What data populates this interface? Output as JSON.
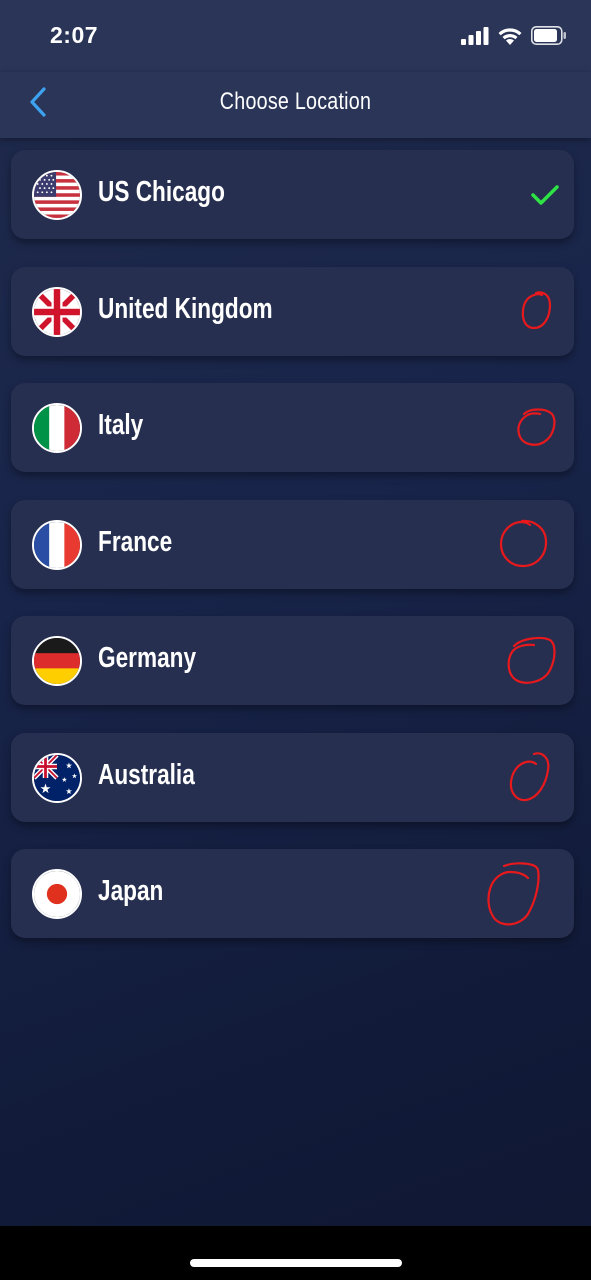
{
  "status_bar": {
    "time": "2:07"
  },
  "nav": {
    "title": "Choose Location",
    "back_icon": "chevron-left-icon"
  },
  "colors": {
    "accent_blue": "#3da2f0",
    "check_green": "#2ee344",
    "annotation_red": "#e8191c",
    "card_bg": "#262f4f"
  },
  "locations": [
    {
      "name": "US Chicago",
      "flag_icon": "us-flag-icon",
      "status_icon": "checkmark-icon",
      "selected": true
    },
    {
      "name": "United Kingdom",
      "flag_icon": "uk-flag-icon",
      "status_icon": "red-circle-annotation",
      "selected": false
    },
    {
      "name": "Italy",
      "flag_icon": "italy-flag-icon",
      "status_icon": "red-circle-annotation",
      "selected": false
    },
    {
      "name": "France",
      "flag_icon": "france-flag-icon",
      "status_icon": "red-circle-annotation",
      "selected": false
    },
    {
      "name": "Germany",
      "flag_icon": "germany-flag-icon",
      "status_icon": "red-circle-annotation",
      "selected": false
    },
    {
      "name": "Australia",
      "flag_icon": "australia-flag-icon",
      "status_icon": "red-circle-annotation",
      "selected": false
    },
    {
      "name": "Japan",
      "flag_icon": "japan-flag-icon",
      "status_icon": "red-circle-annotation",
      "selected": false
    }
  ]
}
